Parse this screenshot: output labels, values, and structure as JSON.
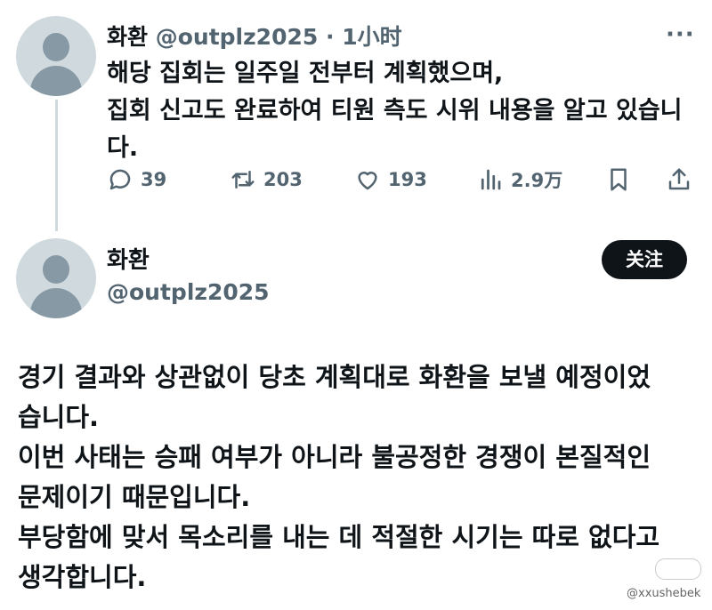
{
  "tweet1": {
    "name": "화환",
    "handle": "@outplz2025",
    "separator": "·",
    "time": "1小时",
    "more_icon": "more-icon",
    "lines": [
      "해당 집회는 일주일 전부터 계획했으며,",
      "집회 신고도 완료하여 티원 측도 시위 내용을 알고 있습니",
      "다."
    ],
    "actions": {
      "reply": {
        "icon": "reply-icon",
        "count": "39"
      },
      "retweet": {
        "icon": "retweet-icon",
        "count": "203"
      },
      "like": {
        "icon": "heart-icon",
        "count": "193"
      },
      "views": {
        "icon": "views-icon",
        "count": "2.9万"
      },
      "bookmark": {
        "icon": "bookmark-icon"
      },
      "share": {
        "icon": "share-icon"
      }
    }
  },
  "tweet2": {
    "name": "화환",
    "handle": "@outplz2025",
    "follow_label": "关注",
    "lines": [
      "경기 결과와 상관없이 당초 계획대로 화환을 보낼 예정이었",
      "습니다.",
      "이번 사태는 승패 여부가 아니라 불공정한 경쟁이 본질적인",
      "문제이기 때문입니다.",
      "부당함에 맞서 목소리를 내는 데 적절한 시기는 따로 없다고",
      "생각합니다."
    ]
  },
  "watermark": "@xxushebek",
  "colors": {
    "text": "#0f1419",
    "muted": "#536471",
    "avatar_bg": "#cfd9de",
    "avatar_fg": "#8899a6",
    "button_bg": "#0f1419"
  }
}
